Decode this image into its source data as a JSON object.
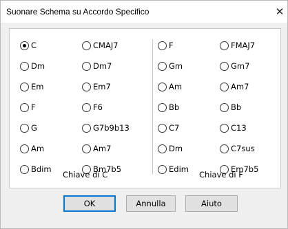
{
  "window": {
    "title": "Suonare Schema su Accordo Specifico",
    "close_glyph": "✕"
  },
  "columns": [
    {
      "items": [
        "C",
        "Dm",
        "Em",
        "F",
        "G",
        "Am",
        "Bdim"
      ]
    },
    {
      "items": [
        "CMAJ7",
        "Dm7",
        "Em7",
        "F6",
        "G7b9b13",
        "Am7",
        "Bm7b5"
      ]
    },
    {
      "items": [
        "F",
        "Gm",
        "Am",
        "Bb",
        "C7",
        "Dm",
        "Edim"
      ]
    },
    {
      "items": [
        "FMAJ7",
        "Gm7",
        "Am7",
        "Bb",
        "C13",
        "C7sus",
        "Em7b5"
      ]
    }
  ],
  "selected": "C",
  "keys": {
    "left": "Chiave di C",
    "right": "Chiave di F"
  },
  "buttons": {
    "ok": "OK",
    "cancel": "Annulla",
    "help": "Aiuto"
  }
}
